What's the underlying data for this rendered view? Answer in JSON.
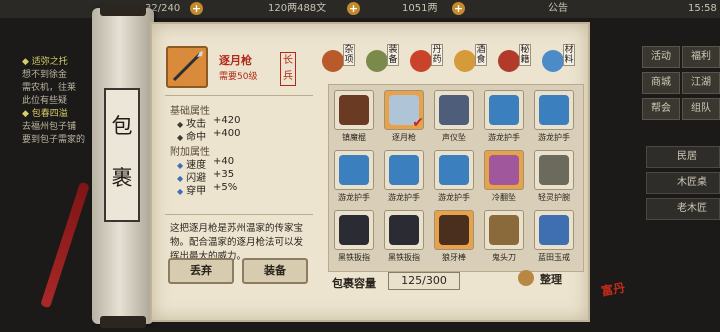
{
  "topbar": {
    "stamina": "32/240",
    "silver": "120两488文",
    "gold": "1051两",
    "notice": "公告",
    "time": "15:58"
  },
  "quest_log": {
    "quest1_title": "◆ 适弥之托",
    "quest1_lines": [
      "想不到徐金",
      "需农机，往莱",
      "此位有些疑"
    ],
    "quest2_title": "◆ 包春四溢",
    "quest2_lines": [
      "去福州包子铺",
      "要到包子需家的"
    ]
  },
  "right_menu": {
    "btn_activity": "活动",
    "btn_welfare": "福利",
    "btn_shop": "商城",
    "btn_ranking": "江湖",
    "btn_guild": "帮会",
    "btn_party": "组队",
    "row1": "民居",
    "row2": "木匠桌",
    "row3": "老木匠"
  },
  "bag": {
    "title_char1": "包",
    "title_char2": "裹"
  },
  "selected_item": {
    "name": "逐月枪",
    "requirement": "需要50级",
    "type": "长兵",
    "base_title": "基础属性",
    "base_attrs": [
      {
        "name": "攻击",
        "value": "+420"
      },
      {
        "name": "命中",
        "value": "+400"
      }
    ],
    "extra_title": "附加属性",
    "extra_attrs": [
      {
        "name": "速度",
        "value": "+40"
      },
      {
        "name": "闪避",
        "value": "+35"
      },
      {
        "name": "穿甲",
        "value": "+5%"
      }
    ],
    "description": "这把逐月枪是苏州温家的传家宝物。配合温家的逐月枪法可以发挥出最大的威力。",
    "btn_discard": "丢弃",
    "btn_equip": "装备"
  },
  "categories": [
    {
      "label": "杂项",
      "color": "#b85a2a"
    },
    {
      "label": "装备",
      "color": "#7a8a4a"
    },
    {
      "label": "丹药",
      "color": "#c8432a"
    },
    {
      "label": "酒食",
      "color": "#d59a3a"
    },
    {
      "label": "秘籍",
      "color": "#b23a2a"
    },
    {
      "label": "材料",
      "color": "#4a8bc8"
    }
  ],
  "items": [
    {
      "name": "镇魔棍",
      "color": "#6b3a22",
      "checked": false,
      "bg": "#e9e1cc"
    },
    {
      "name": "逐月枪",
      "color": "#b0c4d8",
      "checked": true,
      "bg": "#e8a24a"
    },
    {
      "name": "声仪坠",
      "color": "#4d5d7a",
      "checked": false,
      "bg": "#e9e1cc"
    },
    {
      "name": "游龙护手",
      "color": "#3b7fbf",
      "checked": false,
      "bg": "#e9e1cc"
    },
    {
      "name": "游龙护手",
      "color": "#3b7fbf",
      "checked": false,
      "bg": "#e9e1cc"
    },
    {
      "name": "游龙护手",
      "color": "#3b7fbf",
      "checked": false,
      "bg": "#e9e1cc"
    },
    {
      "name": "游龙护手",
      "color": "#3b7fbf",
      "checked": false,
      "bg": "#e9e1cc"
    },
    {
      "name": "游龙护手",
      "color": "#3b7fbf",
      "checked": false,
      "bg": "#e9e1cc"
    },
    {
      "name": "冷翻坠",
      "color": "#a0579c",
      "checked": false,
      "bg": "#e8a24a"
    },
    {
      "name": "轻灵护腕",
      "color": "#6c6a5d",
      "checked": false,
      "bg": "#e9e1cc"
    },
    {
      "name": "黑铁扳指",
      "color": "#2a2b33",
      "checked": false,
      "bg": "#e9e1cc"
    },
    {
      "name": "黑铁扳指",
      "color": "#2a2b33",
      "checked": false,
      "bg": "#e9e1cc"
    },
    {
      "name": "狼牙棒",
      "color": "#4a2e1e",
      "checked": false,
      "bg": "#e8a24a"
    },
    {
      "name": "鬼头刀",
      "color": "#8a6a3a",
      "checked": false,
      "bg": "#e9e1cc"
    },
    {
      "name": "蓝田玉戒",
      "color": "#3f6fb0",
      "checked": false,
      "bg": "#e9e1cc"
    }
  ],
  "capacity": {
    "label": "包裹容量",
    "value": "125/300"
  },
  "sort_label": "整理",
  "stamp_text": "富丹"
}
